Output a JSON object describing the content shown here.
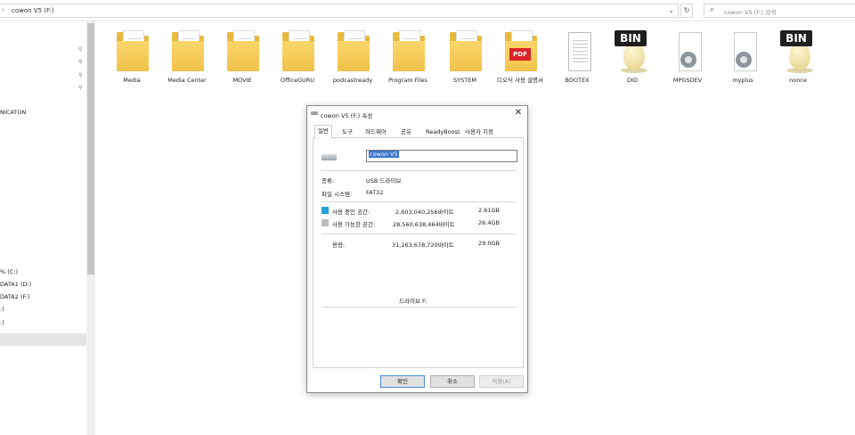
{
  "addressbar": {
    "path": "cowon V5 (F:)"
  },
  "search": {
    "placeholder": "cowon V5 (F:) 검색"
  },
  "nav": {
    "items": [
      "NICATON",
      "% (C:)",
      "DATA1 (D:)",
      "DATA2 (F:)",
      ":)",
      ":)"
    ]
  },
  "files": [
    {
      "name": "Media",
      "type": "folder"
    },
    {
      "name": "Media Center",
      "type": "folder"
    },
    {
      "name": "MOVIE",
      "type": "folder"
    },
    {
      "name": "OfficeGURU",
      "type": "folder"
    },
    {
      "name": "podcastready",
      "type": "folder"
    },
    {
      "name": "Program Files",
      "type": "folder"
    },
    {
      "name": "SYSTEM",
      "type": "folder"
    },
    {
      "name": "디오딕 사용 설명서",
      "type": "folder-pdf"
    },
    {
      "name": "BOOTEX",
      "type": "doc"
    },
    {
      "name": "DID",
      "type": "bin"
    },
    {
      "name": "MPGSDEV",
      "type": "gear"
    },
    {
      "name": "myplus",
      "type": "gear"
    },
    {
      "name": "nonce",
      "type": "bin"
    }
  ],
  "bin_label": "BIN",
  "pdf_label": "PDF",
  "dialog": {
    "title": "cowon V5 (F:) 속성",
    "tabs": [
      "일반",
      "도구",
      "하드웨어",
      "공유",
      "ReadyBoost",
      "사용자 지정"
    ],
    "name_value": "cowon V5",
    "type_label": "종류:",
    "type_value": "USB 드라이브",
    "fs_label": "파일 시스템:",
    "fs_value": "FAT32",
    "used_label": "사용 중인 공간:",
    "used_bytes": "2,603,040,256바이트",
    "used_gb": "2.61GB",
    "free_label": "사용 가능한 공간:",
    "free_bytes": "28,560,638,464바이트",
    "free_gb": "26.4GB",
    "cap_label": "용량:",
    "cap_bytes": "31,163,678,720바이트",
    "cap_gb": "29.0GB",
    "drive_label": "드라이브 F:",
    "ok": "확인",
    "cancel": "취소",
    "apply": "적용(A)",
    "colors": {
      "used": "#26a0da",
      "free": "#bcbcbc"
    }
  }
}
